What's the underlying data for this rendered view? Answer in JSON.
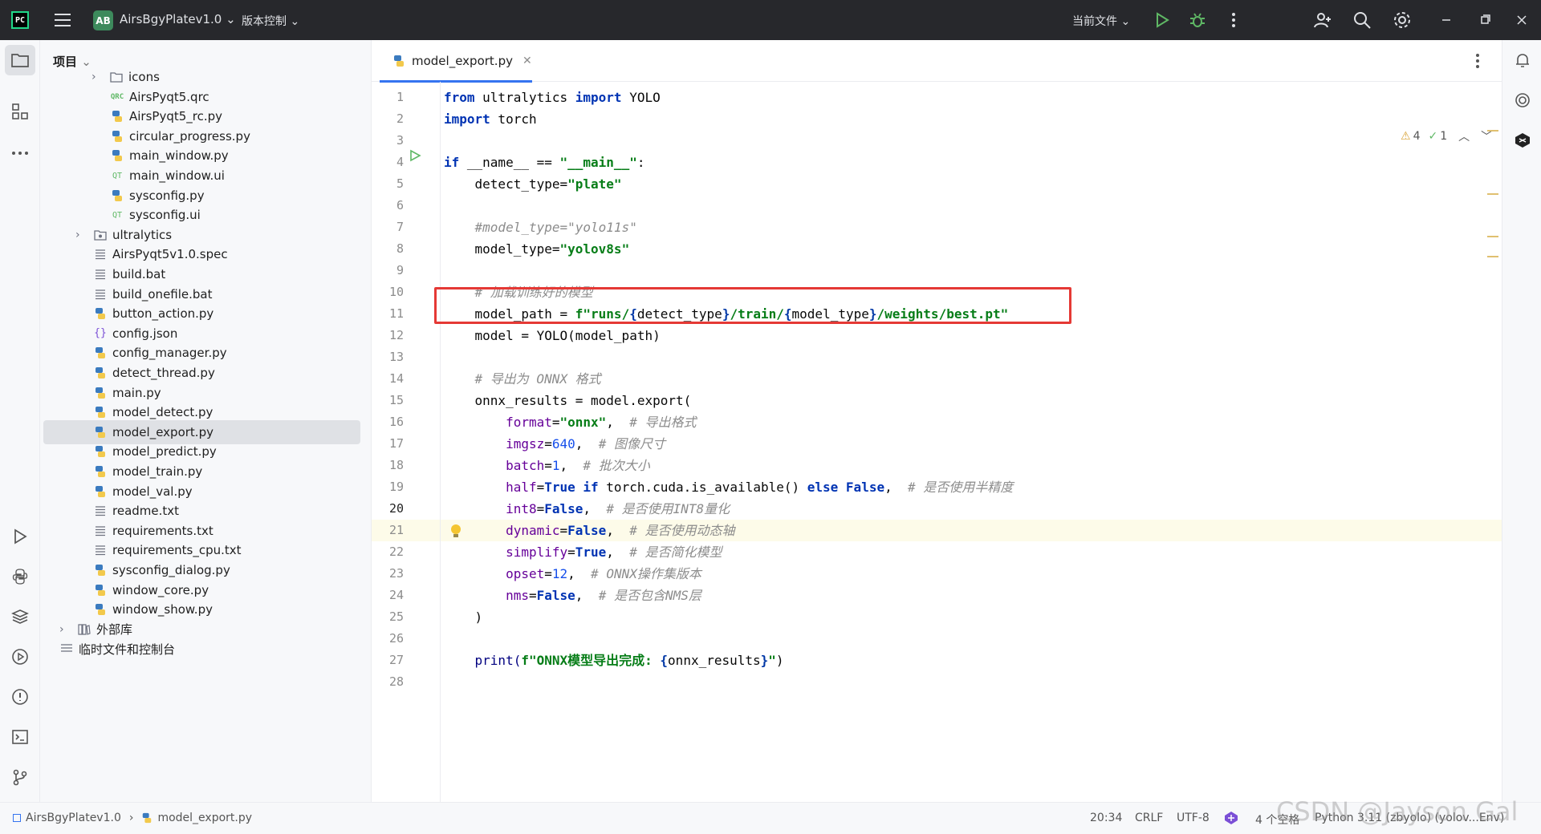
{
  "titlebar": {
    "logo": "PC",
    "project_badge": "AB",
    "project_name": "AirsBgyPlatev1.0",
    "vcs_label": "版本控制",
    "run_config": "当前文件"
  },
  "project_panel": {
    "header": "项目",
    "items": [
      {
        "name": "icons",
        "type": "folder",
        "icon": "folder-icon"
      },
      {
        "name": "AirsPyqt5.qrc",
        "type": "qrc",
        "icon": "qrc-file-icon"
      },
      {
        "name": "AirsPyqt5_rc.py",
        "type": "py",
        "icon": "python-file-icon"
      },
      {
        "name": "circular_progress.py",
        "type": "py",
        "icon": "python-file-icon"
      },
      {
        "name": "main_window.py",
        "type": "py",
        "icon": "python-file-icon"
      },
      {
        "name": "main_window.ui",
        "type": "ui",
        "icon": "qt-ui-file-icon"
      },
      {
        "name": "sysconfig.py",
        "type": "py",
        "icon": "python-file-icon"
      },
      {
        "name": "sysconfig.ui",
        "type": "ui",
        "icon": "qt-ui-file-icon"
      },
      {
        "name": "ultralytics",
        "type": "folder",
        "icon": "package-folder-icon"
      },
      {
        "name": "AirsPyqt5v1.0.spec",
        "type": "txt",
        "icon": "text-file-icon"
      },
      {
        "name": "build.bat",
        "type": "txt",
        "icon": "text-file-icon"
      },
      {
        "name": "build_onefile.bat",
        "type": "txt",
        "icon": "text-file-icon"
      },
      {
        "name": "button_action.py",
        "type": "py",
        "icon": "python-file-icon"
      },
      {
        "name": "config.json",
        "type": "json",
        "icon": "json-file-icon"
      },
      {
        "name": "config_manager.py",
        "type": "py",
        "icon": "python-file-icon"
      },
      {
        "name": "detect_thread.py",
        "type": "py",
        "icon": "python-file-icon"
      },
      {
        "name": "main.py",
        "type": "py",
        "icon": "python-file-icon"
      },
      {
        "name": "model_detect.py",
        "type": "py",
        "icon": "python-file-icon"
      },
      {
        "name": "model_export.py",
        "type": "py",
        "icon": "python-file-icon",
        "selected": true
      },
      {
        "name": "model_predict.py",
        "type": "py",
        "icon": "python-file-icon"
      },
      {
        "name": "model_train.py",
        "type": "py",
        "icon": "python-file-icon"
      },
      {
        "name": "model_val.py",
        "type": "py",
        "icon": "python-file-icon"
      },
      {
        "name": "readme.txt",
        "type": "txt",
        "icon": "text-file-icon"
      },
      {
        "name": "requirements.txt",
        "type": "txt",
        "icon": "text-file-icon"
      },
      {
        "name": "requirements_cpu.txt",
        "type": "txt",
        "icon": "text-file-icon"
      },
      {
        "name": "sysconfig_dialog.py",
        "type": "py",
        "icon": "python-file-icon"
      },
      {
        "name": "window_core.py",
        "type": "py",
        "icon": "python-file-icon"
      },
      {
        "name": "window_show.py",
        "type": "py",
        "icon": "python-file-icon"
      },
      {
        "name": "外部库",
        "type": "lib",
        "icon": "library-icon"
      },
      {
        "name": "临时文件和控制台",
        "type": "scratch",
        "icon": "scratch-icon"
      }
    ]
  },
  "editor": {
    "tab_label": "model_export.py",
    "inspections": {
      "warnings": "4",
      "ok": "1"
    },
    "lines": [
      "1",
      "2",
      "3",
      "4",
      "5",
      "6",
      "7",
      "8",
      "9",
      "10",
      "11",
      "12",
      "13",
      "14",
      "15",
      "16",
      "17",
      "18",
      "19",
      "20",
      "21",
      "22",
      "23",
      "24",
      "25",
      "26",
      "27",
      "28"
    ],
    "code": {
      "l1_from": "from",
      "l1_mod": " ultralytics ",
      "l1_import": "import",
      "l1_name": " YOLO",
      "l2_import": "import",
      "l2_name": " torch",
      "l4_if": "if",
      "l4_mid": " __name__ == ",
      "l4_str": "\"__main__\"",
      "l4_end": ":",
      "l5_var": "    detect_type=",
      "l5_str": "\"plate\"",
      "l7_cm": "    #model_type=\"yolo11s\"",
      "l8_var": "    model_type=",
      "l8_str": "\"yolov8s\"",
      "l10_cm": "    # 加载训练好的模型",
      "l11_var": "    model_path = ",
      "l11_f": "f\"runs/",
      "l11_a": "{",
      "l11_b": "detect_type",
      "l11_c": "}",
      "l11_d": "/train/",
      "l11_e": "{",
      "l11_g": "model_type",
      "l11_h": "}",
      "l11_i": "/weights/best.pt\"",
      "l12": "    model = YOLO(model_path)",
      "l14_cm": "    # 导出为 ONNX 格式",
      "l15": "    onnx_results = model.export(",
      "l16_k": "        format",
      "l16_eq": "=",
      "l16_v": "\"onnx\"",
      "l16_c": ",  ",
      "l16_cm": "# 导出格式",
      "l17_k": "        imgsz",
      "l17_eq": "=",
      "l17_v": "640",
      "l17_c": ",  ",
      "l17_cm": "# 图像尺寸",
      "l18_k": "        batch",
      "l18_eq": "=",
      "l18_v": "1",
      "l18_c": ",  ",
      "l18_cm": "# 批次大小",
      "l19_k": "        half",
      "l19_eq": "=",
      "l19_v": "True",
      "l19_if": " if ",
      "l19_mid": "torch.cuda.is_available() ",
      "l19_else": "else",
      "l19_sp": " ",
      "l19_f": "False",
      "l19_c": ",  ",
      "l19_cm": "# 是否使用半精度",
      "l20_k": "        int8",
      "l20_eq": "=",
      "l20_v": "False",
      "l20_c": ",  ",
      "l20_cm": "# 是否使用INT8量化",
      "l21_k": "        dynamic",
      "l21_eq": "=",
      "l21_v": "False",
      "l21_c": ",  ",
      "l21_cm": "# 是否使用动态轴",
      "l22_k": "        simplify",
      "l22_eq": "=",
      "l22_v": "True",
      "l22_c": ",  ",
      "l22_cm": "# 是否简化模型",
      "l23_k": "        opset",
      "l23_eq": "=",
      "l23_v": "12",
      "l23_c": ",  ",
      "l23_cm": "# ONNX操作集版本",
      "l24_k": "        nms",
      "l24_eq": "=",
      "l24_v": "False",
      "l24_c": ",  ",
      "l24_cm": "# 是否包含NMS层",
      "l25": "    )",
      "l27_p": "    print(",
      "l27_s": "f\"ONNX模型导出完成: ",
      "l27_a": "{",
      "l27_b": "onnx_results",
      "l27_cc": "}",
      "l27_d": "\"",
      "l27_e": ")"
    }
  },
  "statusbar": {
    "breadcrumb_project": "AirsBgyPlatev1.0",
    "breadcrumb_file": "model_export.py",
    "position": "20:34",
    "line_sep": "CRLF",
    "encoding": "UTF-8",
    "indent": "4 个空格",
    "interpreter": "Python 3.11 (zbyolo) (yolov...Env)"
  },
  "watermark": "CSDN @Jayson Gal"
}
